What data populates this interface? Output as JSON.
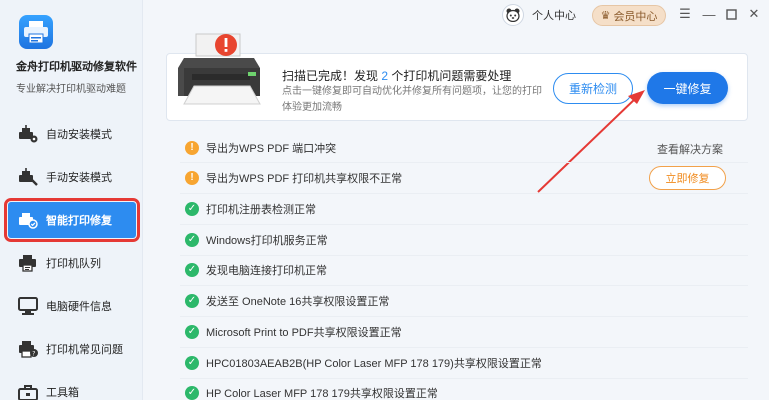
{
  "app": {
    "name": "金舟打印机驱动修复软件",
    "subtitle": "专业解决打印机驱动难题"
  },
  "topbar": {
    "user_label": "个人中心",
    "vip_label": "会员中心",
    "menu_icon": "menu-icon",
    "minimize_icon": "minimize-icon",
    "maximize_icon": "maximize-icon",
    "close_icon": "close-icon"
  },
  "sidebar": {
    "items": [
      {
        "label": "自动安装模式",
        "icon": "auto-install-icon"
      },
      {
        "label": "手动安装模式",
        "icon": "manual-install-icon"
      },
      {
        "label": "智能打印修复",
        "icon": "smart-repair-icon",
        "active": true
      },
      {
        "label": "打印机队列",
        "icon": "printer-queue-icon"
      },
      {
        "label": "电脑硬件信息",
        "icon": "hardware-info-icon"
      },
      {
        "label": "打印机常见问题",
        "icon": "faq-icon"
      },
      {
        "label": "工具箱",
        "icon": "toolbox-icon"
      }
    ]
  },
  "banner": {
    "title_prefix": "扫描已完成！发现",
    "count": "2",
    "title_suffix": "个打印机问题需要处理",
    "desc": "点击一键修复即可自动优化并修复所有问题项，让您的打印体验更加流畅",
    "rescan_label": "重新检测",
    "fix_all_label": "一键修复"
  },
  "problems": [
    {
      "text": "导出为WPS PDF 端口冲突",
      "status": "warning"
    },
    {
      "text": "导出为WPS PDF 打印机共享权限不正常",
      "status": "warning"
    },
    {
      "text": "打印机注册表检测正常",
      "status": "ok"
    },
    {
      "text": "Windows打印机服务正常",
      "status": "ok"
    },
    {
      "text": "发现电脑连接打印机正常",
      "status": "ok"
    },
    {
      "text": "发送至 OneNote 16共享权限设置正常",
      "status": "ok"
    },
    {
      "text": "Microsoft Print to PDF共享权限设置正常",
      "status": "ok"
    },
    {
      "text": "HPC01803AEAB2B(HP Color Laser MFP 178 179)共享权限设置正常",
      "status": "ok"
    },
    {
      "text": "HP Color Laser MFP 178 179共享权限设置正常",
      "status": "ok"
    }
  ],
  "actions": {
    "view_solution": "查看解决方案",
    "fix_now": "立即修复"
  },
  "colors": {
    "accent": "#2d8cf0",
    "warning": "#f7a531",
    "ok": "#2cb86a",
    "highlight": "#e53935"
  }
}
